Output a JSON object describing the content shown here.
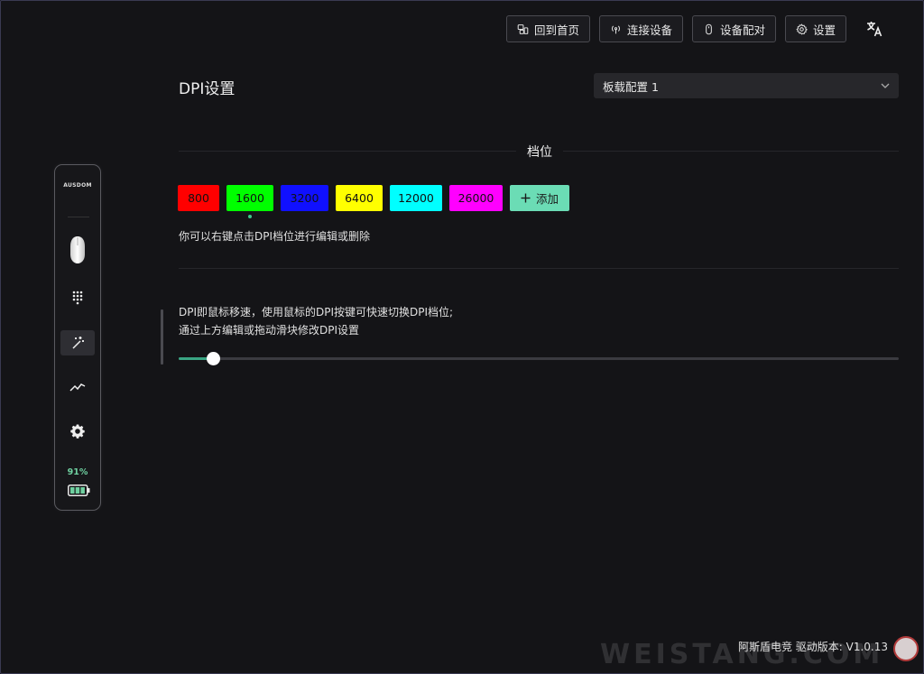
{
  "topbar": {
    "home_label": "回到首页",
    "connect_label": "连接设备",
    "pair_label": "设备配对",
    "settings_label": "设置"
  },
  "sidebar": {
    "logo": "AUSDOM",
    "battery_pct": "91%",
    "battery_level": 0.91
  },
  "main": {
    "title": "DPI设置",
    "profile_select": "板载配置 1",
    "section_title": "档位",
    "dpi_levels": [
      {
        "value": "800",
        "color": "#ff0000"
      },
      {
        "value": "1600",
        "color": "#00ff00"
      },
      {
        "value": "3200",
        "color": "#1010ff"
      },
      {
        "value": "6400",
        "color": "#ffff00"
      },
      {
        "value": "12000",
        "color": "#00ffff"
      },
      {
        "value": "26000",
        "color": "#ff00ff"
      }
    ],
    "active_level_index": 1,
    "add_label": "添加",
    "hint": "你可以右键点击DPI档位进行编辑或删除",
    "desc_line1": "DPI即鼠标移速，使用鼠标的DPI按键可快速切换DPI档位;",
    "desc_line2": "通过上方编辑或拖动滑块修改DPI设置",
    "slider_fraction": 0.048
  },
  "footer": {
    "version": "阿斯盾电竞 驱动版本: V1.0.13"
  },
  "watermark": "WEISTANG.COM",
  "colors": {
    "accent": "#6bdcb5",
    "slider_fill": "#3aa583",
    "battery": "#6fd0a0"
  }
}
